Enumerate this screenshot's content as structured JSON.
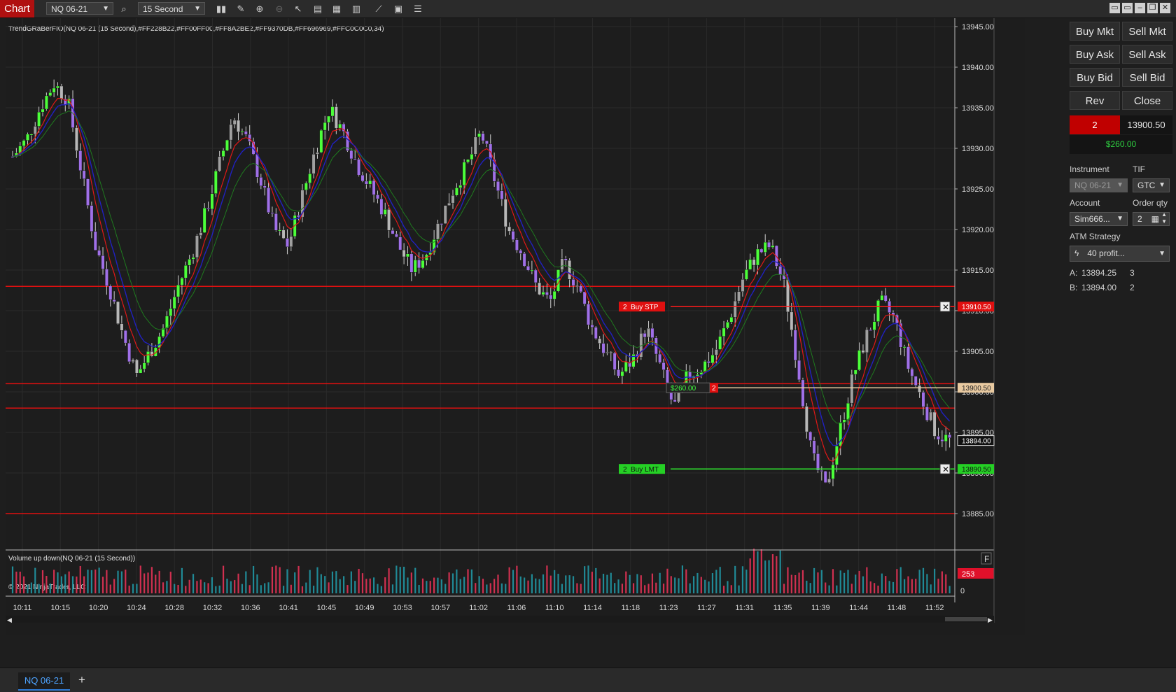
{
  "toolbar": {
    "chart_label": "Chart",
    "instrument": "NQ 06-21",
    "interval": "15 Second",
    "icons": [
      "search-icon",
      "candlestick-icon",
      "draw-icon",
      "zoom-in-icon",
      "zoom-out-icon",
      "pointer-icon",
      "data-box-icon",
      "strategies-icon",
      "chart-trader-icon",
      "indicators-icon",
      "properties-icon",
      "list-icon"
    ]
  },
  "indicator_label": "TrendGRaBerFIO(NQ 06-21 (15 Second),#FF228B22,#FF00FF00,#FF8A2BE2,#FF9370DB,#FF696969,#FFC0C0C0,34)",
  "volume_label": "Volume up down(NQ 06-21 (15 Second))",
  "copyright": "© 2021 NinjaTrader, LLC",
  "price_axis": [
    "13945.00",
    "13940.00",
    "13935.00",
    "13930.00",
    "13925.00",
    "13920.00",
    "13915.00",
    "13910.00",
    "13905.00",
    "13900.00",
    "13895.00",
    "13890.00",
    "13885.00"
  ],
  "volume_axis": {
    "zero": "0",
    "last_volume": "253",
    "panel_button": "F"
  },
  "time_axis": [
    "10:11",
    "10:15",
    "10:20",
    "10:24",
    "10:28",
    "10:32",
    "10:36",
    "10:41",
    "10:45",
    "10:49",
    "10:53",
    "10:57",
    "11:02",
    "11:06",
    "11:10",
    "11:14",
    "11:18",
    "11:23",
    "11:27",
    "11:31",
    "11:35",
    "11:39",
    "11:44",
    "11:48",
    "11:52"
  ],
  "orders": {
    "buy_stop": {
      "qty": "2",
      "label": "Buy STP",
      "price": "13910.50"
    },
    "buy_limit": {
      "qty": "2",
      "label": "Buy LMT",
      "price": "13890.50"
    },
    "position": {
      "pnl": "$260.00",
      "qty": "2",
      "price": "13900.50"
    },
    "last_price": "13894.00"
  },
  "chart_data": {
    "type": "candlestick",
    "ylim": [
      13882,
      13946
    ],
    "horizontal_lines": [
      13913,
      13901,
      13898,
      13885
    ],
    "price_series": [
      13929,
      13931,
      13935,
      13938,
      13936,
      13927,
      13918,
      13913,
      13907,
      13902,
      13905,
      13908,
      13913,
      13917,
      13922,
      13928,
      13934,
      13931,
      13926,
      13920,
      13918,
      13924,
      13930,
      13935,
      13932,
      13928,
      13925,
      13922,
      13918,
      13915,
      13917,
      13921,
      13925,
      13928,
      13932,
      13926,
      13920,
      13917,
      13913,
      13911,
      13916,
      13913,
      13908,
      13905,
      13902,
      13904,
      13908,
      13903,
      13898,
      13902,
      13903,
      13905,
      13909,
      13914,
      13917,
      13918,
      13913,
      13903,
      13892,
      13888,
      13895,
      13902,
      13907,
      13911,
      13909,
      13903,
      13899,
      13895,
      13894
    ]
  },
  "side_panel": {
    "buttons": [
      "Buy Mkt",
      "Sell Mkt",
      "Buy Ask",
      "Sell Ask",
      "Buy Bid",
      "Sell Bid",
      "Rev",
      "Close"
    ],
    "position_qty": "2",
    "position_price": "13900.50",
    "pnl": "$260.00",
    "instrument_label": "Instrument",
    "instrument_value": "NQ 06-21",
    "tif_label": "TIF",
    "tif_value": "GTC",
    "account_label": "Account",
    "account_value": "Sim666...",
    "order_qty_label": "Order qty",
    "order_qty_value": "2",
    "atm_label": "ATM Strategy",
    "atm_value": "40 profit...",
    "ask_label": "A:",
    "ask_price": "13894.25",
    "ask_size": "3",
    "bid_label": "B:",
    "bid_price": "13894.00",
    "bid_size": "2"
  },
  "bottom_tab": "NQ 06-21"
}
